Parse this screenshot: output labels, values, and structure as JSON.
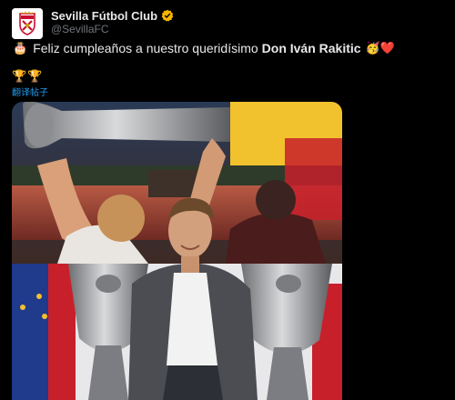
{
  "account": {
    "display_name": "Sevilla Fútbol Club",
    "handle": "@SevillaFC",
    "avatar_icon": "sevilla-crest-icon",
    "verified_icon": "verified-badge-icon",
    "verified_color": "#f4b400"
  },
  "tweet": {
    "leading_emoji": "🎂",
    "text": "Feliz cumpleaños a nuestro queridísimo",
    "highlight": "Don Iván Rakitic",
    "trailing_emoji": "🥳❤️",
    "trophy_emojis": "🏆🏆",
    "translate_label": "翻译帖子"
  },
  "media": {
    "kind": "photo",
    "subject_icon": "player-with-europa-league-trophies-image"
  },
  "colors": {
    "background": "#000000",
    "text": "#e7e9ea",
    "muted": "#71767b",
    "link": "#1d9bf0"
  }
}
